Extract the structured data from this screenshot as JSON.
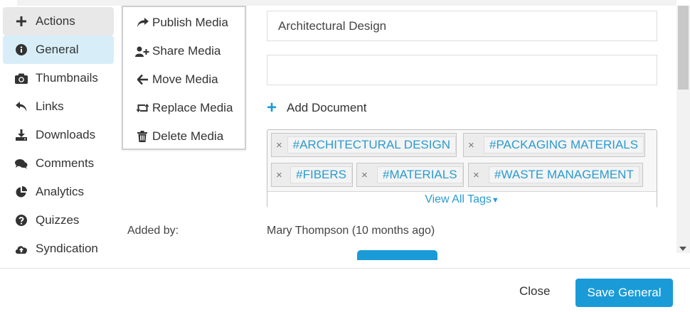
{
  "sidebar": {
    "items": [
      {
        "label": "Actions",
        "icon": "plus-icon"
      },
      {
        "label": "General",
        "icon": "info-icon"
      },
      {
        "label": "Thumbnails",
        "icon": "camera-icon"
      },
      {
        "label": "Links",
        "icon": "reply-icon"
      },
      {
        "label": "Downloads",
        "icon": "download-icon"
      },
      {
        "label": "Comments",
        "icon": "comments-icon"
      },
      {
        "label": "Analytics",
        "icon": "pie-chart-icon"
      },
      {
        "label": "Quizzes",
        "icon": "question-icon"
      },
      {
        "label": "Syndication",
        "icon": "cloud-upload-icon"
      }
    ],
    "active": "General"
  },
  "actions_menu": {
    "items": [
      {
        "label": "Publish Media",
        "icon": "share-arrow-icon"
      },
      {
        "label": "Share Media",
        "icon": "user-plus-icon"
      },
      {
        "label": "Move Media",
        "icon": "arrow-left-icon"
      },
      {
        "label": "Replace Media",
        "icon": "retweet-icon"
      },
      {
        "label": "Delete Media",
        "icon": "trash-icon"
      }
    ]
  },
  "form": {
    "title_value": "Architectural Design",
    "second_value": "",
    "add_document_label": "Add Document",
    "tags": [
      "#ARCHITECTURAL DESIGN",
      "#PACKAGING MATERIALS",
      "#FIBERS",
      "#MATERIALS",
      "#WASTE MANAGEMENT"
    ],
    "tag_remove_glyph": "×",
    "view_all_tags_label": "View All Tags",
    "added_by_label": "Added by:",
    "added_by_value": "Mary Thompson (10 months ago)"
  },
  "footer": {
    "close_label": "Close",
    "save_label": "Save General"
  },
  "colors": {
    "accent": "#1a9bd7",
    "active_bg": "#d7eef9",
    "tag_text": "#2a9bd0"
  }
}
